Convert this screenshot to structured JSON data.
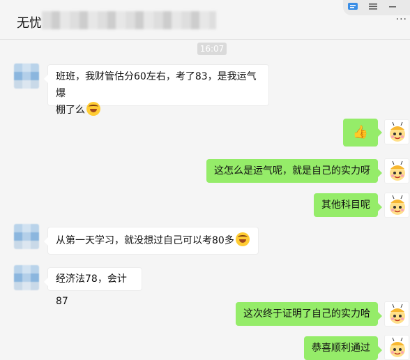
{
  "header": {
    "title": "无忧",
    "icons": [
      "chat-box-icon",
      "menu-icon",
      "more-icon"
    ]
  },
  "timestamp": "16:07",
  "messages": [
    {
      "side": "left",
      "lines": [
        "班班，我财管估分60左右，考了83，是我运气爆",
        "棚了么"
      ],
      "emoji": "laughing-crying-emoji"
    },
    {
      "side": "right",
      "text": "👍",
      "emoji": "thumbs-up"
    },
    {
      "side": "right",
      "text": "这怎么是运气呢，就是自己的实力呀"
    },
    {
      "side": "right",
      "text": "其他科目呢"
    },
    {
      "side": "left",
      "text": "从第一天学习，就没想过自己可以考80多",
      "emoji": "laughing-crying-emoji"
    },
    {
      "side": "left",
      "text": "经济法78，会计87"
    },
    {
      "side": "right",
      "text": "这次终于证明了自己的实力哈"
    },
    {
      "side": "right",
      "text": "恭喜顺利通过"
    }
  ]
}
